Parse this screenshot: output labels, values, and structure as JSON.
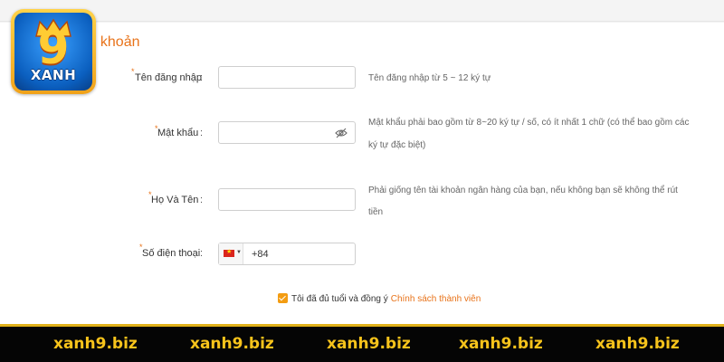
{
  "brand": {
    "logo_text": "XANH",
    "logo_digit": "9"
  },
  "form": {
    "section_title": "ài khoản",
    "required_mark": "*",
    "colon": ":",
    "username": {
      "label": "Tên đăng nhập",
      "value": "",
      "hint": "Tên đăng nhập từ 5 ~ 12 ký tự"
    },
    "password": {
      "label": "Mật khẩu",
      "value": "",
      "hint_line1": "Mật khẩu phải bao gồm từ 8~20 ký tự / số, có ít nhất 1 chữ (có thể bao gồm các",
      "hint_line2": "ký tự đặc biệt)",
      "toggle_icon": "eye-off-icon"
    },
    "fullname": {
      "label": "Họ Và Tên",
      "value": "",
      "hint_line1": "Phải giống tên tài khoản ngân hàng của bạn, nếu không bạn sẽ không thể rút",
      "hint_line2": "tiền"
    },
    "phone": {
      "label": "Số điện thoại",
      "country_code": "+84",
      "flag_icon": "vietnam-flag-icon",
      "value": ""
    },
    "agreement": {
      "checked": true,
      "text": "Tôi đã đủ tuổi và đồng ý",
      "link_text": "Chính sách thành viên"
    }
  },
  "footer": {
    "items": [
      "xanh9.biz",
      "xanh9.biz",
      "xanh9.biz",
      "xanh9.biz",
      "xanh9.biz"
    ],
    "text_color": "#f7c31b"
  },
  "colors": {
    "accent": "#e8731a",
    "checkbox": "#f39c12",
    "footer_bg": "#050505"
  }
}
